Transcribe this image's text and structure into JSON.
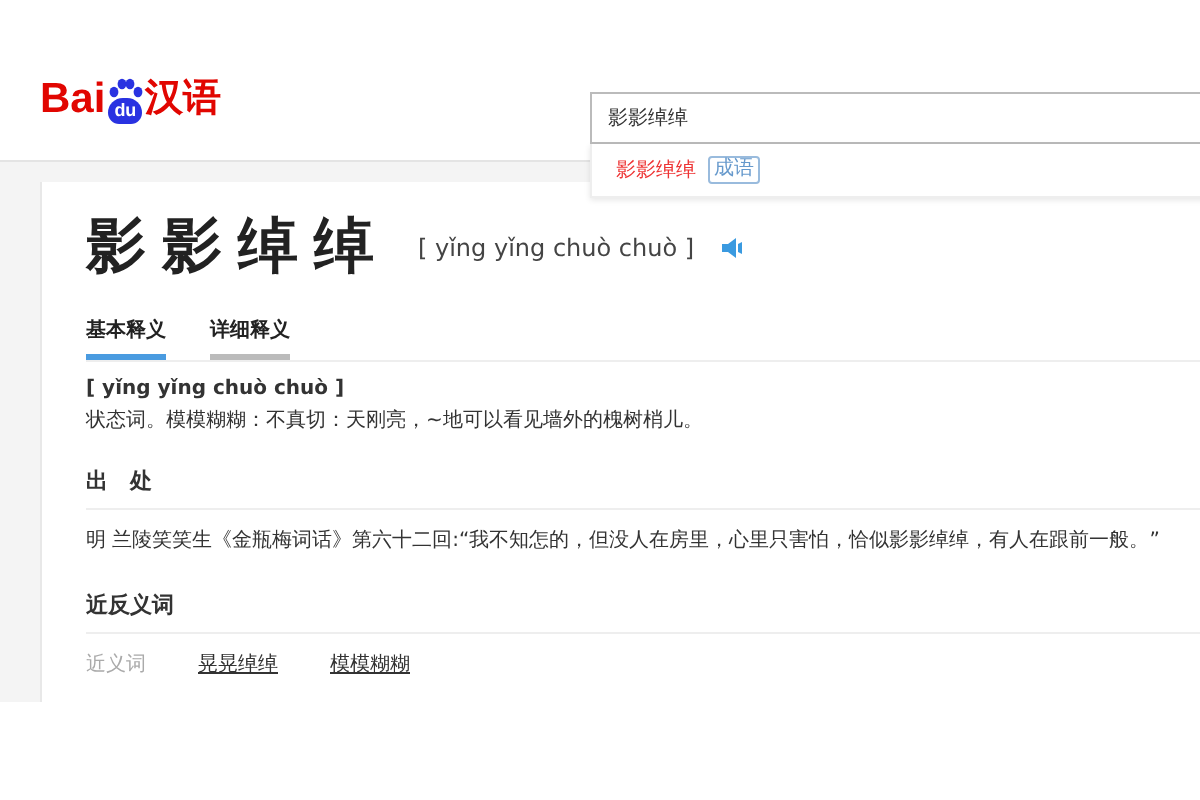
{
  "logo": {
    "brand": "Bai",
    "badge": "du",
    "name": "汉语"
  },
  "search": {
    "value": "影影绰绰",
    "suggestions": [
      {
        "text": "影影绰绰",
        "tag": "成语"
      }
    ]
  },
  "entry": {
    "word": "影影绰绰",
    "pinyin": "[ yǐng yǐng chuò chuò ]"
  },
  "tabs": [
    {
      "label": "基本释义",
      "selected": true
    },
    {
      "label": "详细释义",
      "selected": false
    }
  ],
  "basic": {
    "pinyin": "[ yǐng yǐng chuò chuò ]",
    "definition": "状态词。模模糊糊：不真切：天刚亮，~地可以看见墙外的槐树梢儿。"
  },
  "source": {
    "heading": "出　处",
    "text": "明 兰陵笑笑生《金瓶梅词话》第六十二回:“我不知怎的，但没人在房里，心里只害怕，恰似影影绰绰，有人在跟前一般。”"
  },
  "related": {
    "heading": "近反义词",
    "label": "近义词",
    "words": [
      "晃晃绰绰",
      "模模糊糊"
    ]
  }
}
